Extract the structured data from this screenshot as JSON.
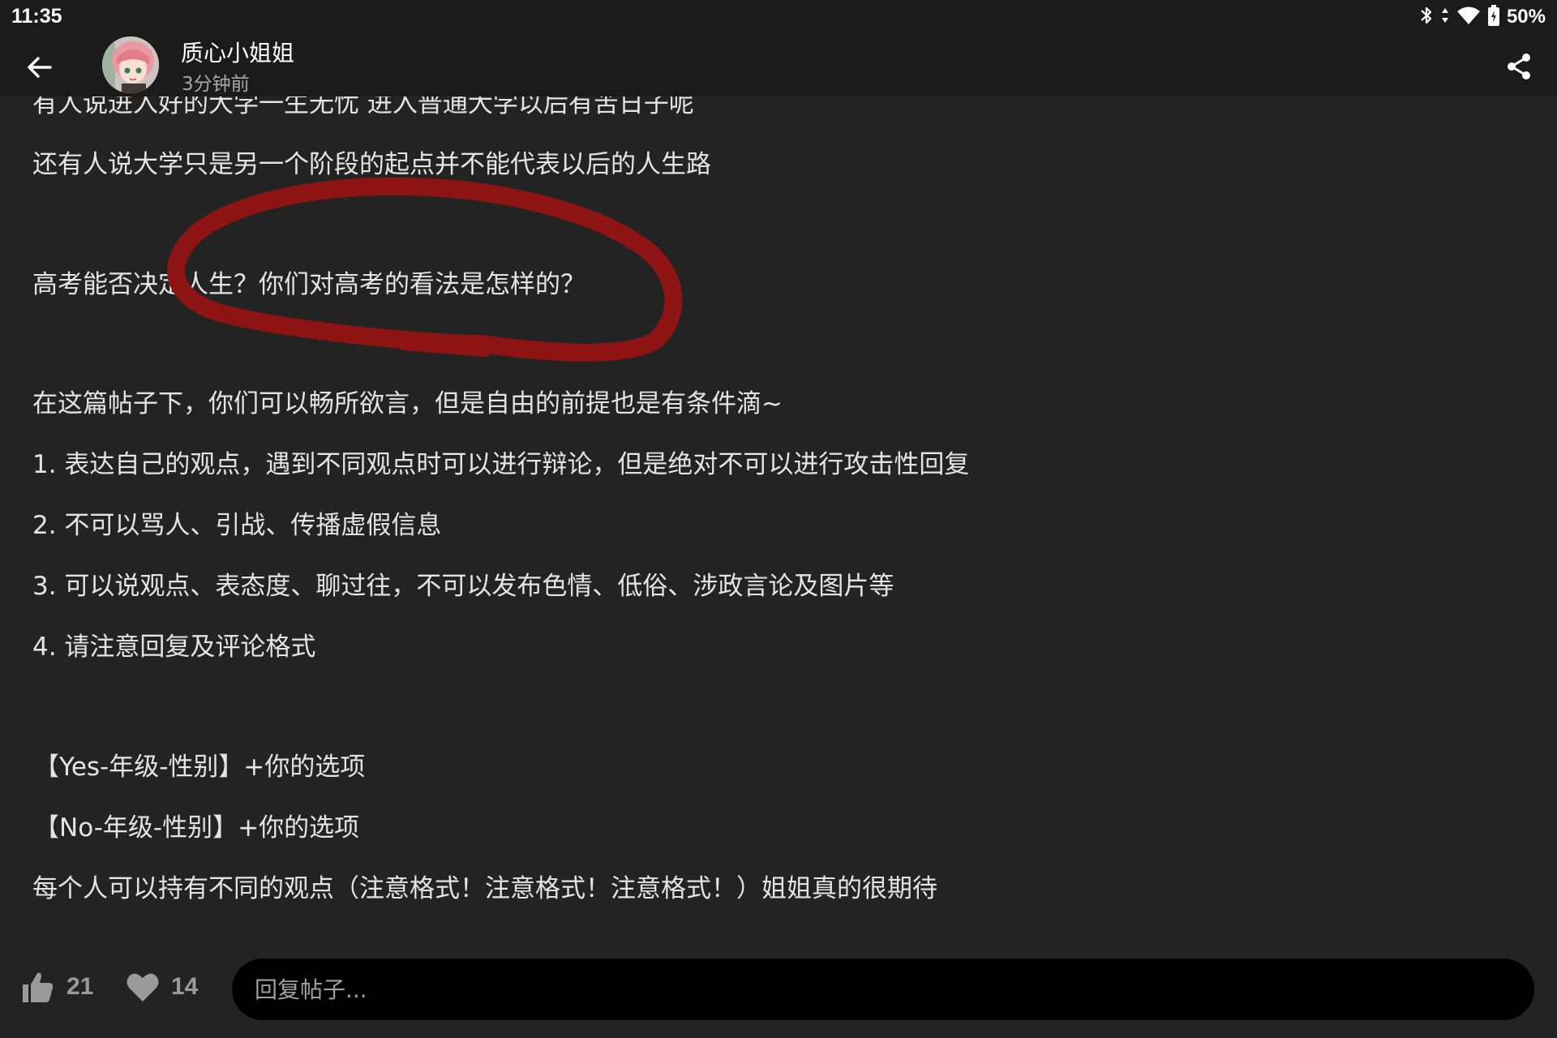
{
  "status_bar": {
    "time": "11:35",
    "battery_text": "50%",
    "icons": [
      "bluetooth-icon",
      "data-arrows-icon",
      "wifi-icon",
      "battery-icon"
    ]
  },
  "header": {
    "author_name": "质心小姐姐",
    "post_time": "3分钟前",
    "back_icon": "arrow-left-icon",
    "share_icon": "share-icon"
  },
  "post": {
    "lines": [
      "有人说进入好的大学一生无忧 进入普通大学以后有苦日子呢",
      "还有人说大学只是另一个阶段的起点并不能代表以后的人生路",
      "高考能否决定人生？你们对高考的看法是怎样的？",
      "在这篇帖子下，你们可以畅所欲言，但是自由的前提也是有条件滴~",
      "1. 表达自己的观点，遇到不同观点时可以进行辩论，但是绝对不可以进行攻击性回复",
      "2. 不可以骂人、引战、传播虚假信息",
      "3. 可以说观点、表态度、聊过往，不可以发布色情、低俗、涉政言论及图片等",
      "4. 请注意回复及评论格式",
      "【Yes-年级-性别】+你的选项",
      "【No-年级-性别】+你的选项",
      "每个人可以持有不同的观点（注意格式！注意格式！注意格式！）姐姐真的很期待"
    ],
    "annotation_color": "#8e1414"
  },
  "bottom_bar": {
    "like_count": "21",
    "favorite_count": "14",
    "reply_placeholder": "回复帖子..."
  },
  "colors": {
    "background": "#232323",
    "bar_background": "#1b1b1b",
    "text": "#e4e4e4",
    "muted": "#9a9a9a"
  }
}
